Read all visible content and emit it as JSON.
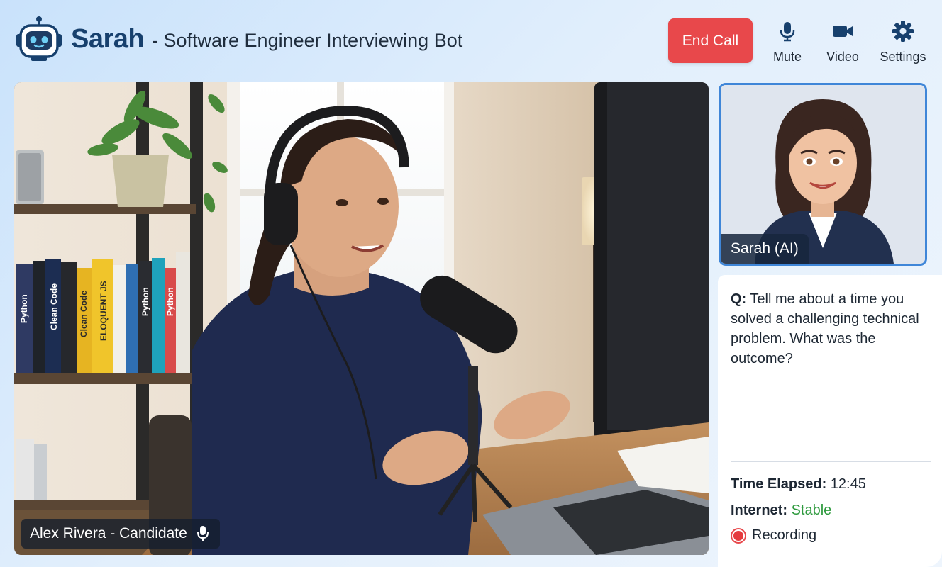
{
  "header": {
    "bot_name": "Sarah",
    "subtitle": "- Software Engineer Interviewing Bot",
    "logo_icon": "robot-icon"
  },
  "controls": {
    "end_call_label": "End Call",
    "mute_label": "Mute",
    "video_label": "Video",
    "settings_label": "Settings"
  },
  "main_video": {
    "candidate_label": "Alex Rivera - Candidate"
  },
  "ai_tile": {
    "label": "Sarah (AI)"
  },
  "panel": {
    "question_prefix": "Q:",
    "question_text": "Tell me about a time you solved a challenging technical problem. What was the outcome?",
    "time_label": "Time Elapsed:",
    "time_value": "12:45",
    "internet_label": "Internet:",
    "internet_value": "Stable",
    "recording_label": "Recording"
  },
  "colors": {
    "accent": "#17406d",
    "end_call": "#e8484b",
    "stable": "#2e9a3e",
    "ai_border": "#3f86d8"
  },
  "book_titles": [
    "Python",
    "Clean Code",
    "Clean Code",
    "ELOQUENT JS",
    "Python",
    "Python"
  ]
}
